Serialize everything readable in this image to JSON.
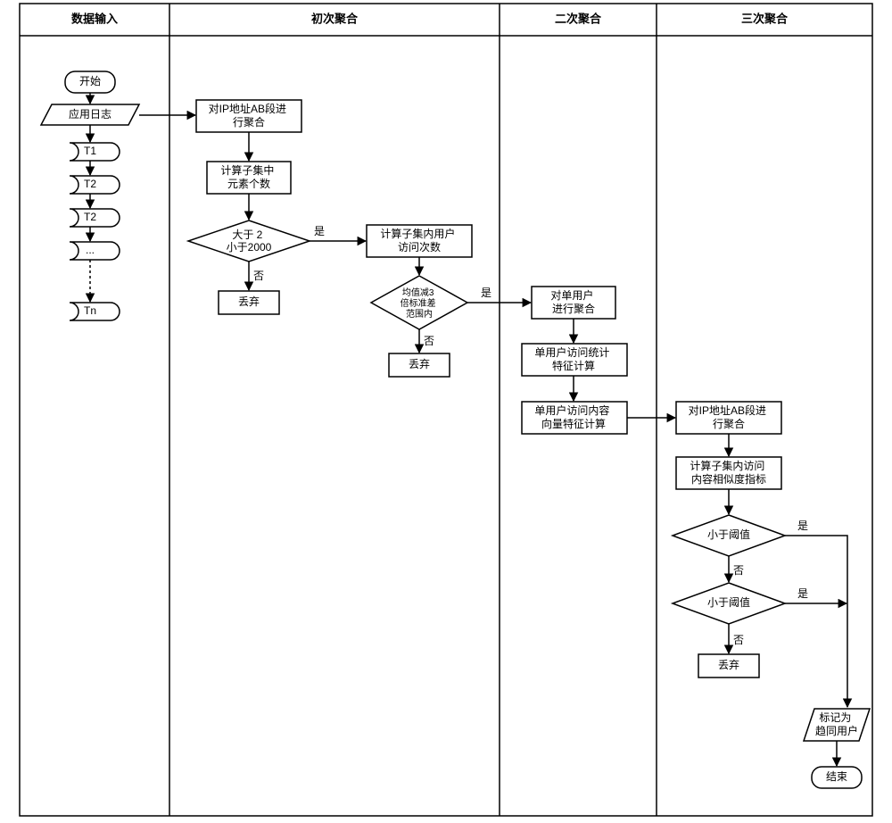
{
  "headers": {
    "col1": "数据输入",
    "col2": "初次聚合",
    "col3": "二次聚合",
    "col4": "三次聚合"
  },
  "labels": {
    "yes": "是",
    "no": "否"
  },
  "col1": {
    "start": "开始",
    "log": "应用日志",
    "t1": "T1",
    "t2a": "T2",
    "t2b": "T2",
    "dots": "...",
    "tn": "Tn"
  },
  "col2": {
    "aggAB": "对IP地址AB段进\n行聚合",
    "countSub": "计算子集中\n元素个数",
    "decRange": "大于 2\n小于2000",
    "discard": "丢弃",
    "countAccess": "计算子集内用户\n访问次数",
    "decStd": "均值减3\n倍标准差\n范围内",
    "discard2": "丢弃"
  },
  "col3": {
    "aggUser": "对单用户\n进行聚合",
    "statCalc": "单用户访问统计\n特征计算",
    "vecCalc": "单用户访问内容\n向量特征计算"
  },
  "col4": {
    "aggAB": "对IP地址AB段进\n行聚合",
    "simCalc": "计算子集内访问\n内容相似度指标",
    "dec1": "小于阈值",
    "dec2": "小于阈值",
    "discard": "丢弃",
    "mark": "标记为\n趋同用户",
    "end": "结束"
  }
}
